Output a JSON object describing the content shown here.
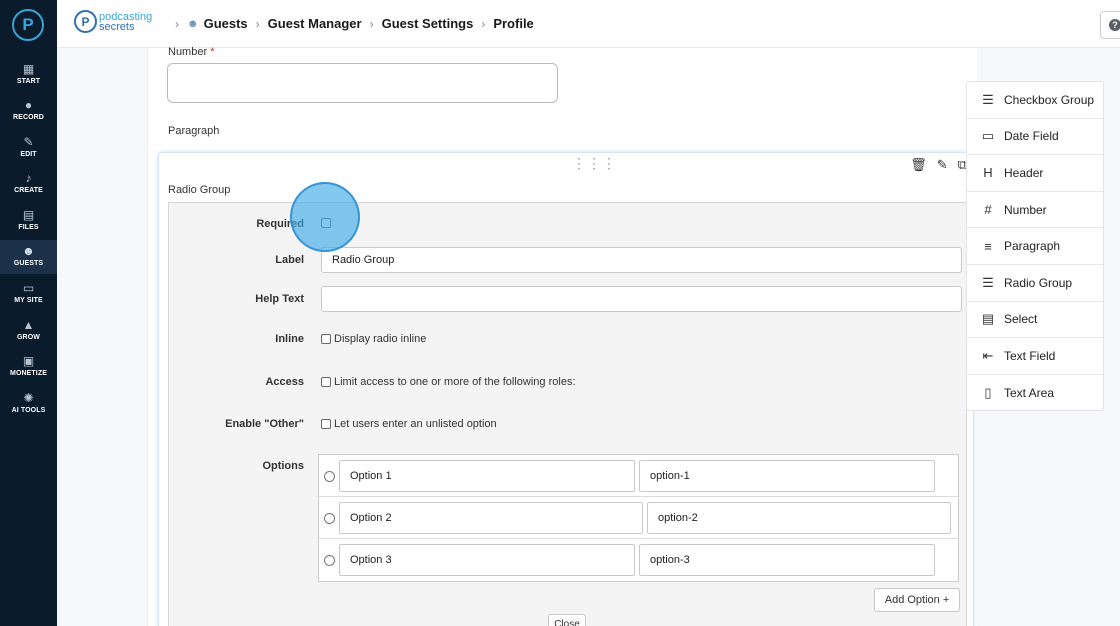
{
  "sidebar": {
    "logo_glyph": "P",
    "items": [
      {
        "label": "START",
        "icon": "start-icon",
        "glyph": "▦"
      },
      {
        "label": "RECORD",
        "icon": "microphone-icon",
        "glyph": "●"
      },
      {
        "label": "EDIT",
        "icon": "edit-icon",
        "glyph": "✎"
      },
      {
        "label": "CREATE",
        "icon": "create-icon",
        "glyph": "♪"
      },
      {
        "label": "FILES",
        "icon": "files-icon",
        "glyph": "▤"
      },
      {
        "label": "GUESTS",
        "icon": "guests-icon",
        "glyph": "☻",
        "active": true
      },
      {
        "label": "MY SITE",
        "icon": "my-site-icon",
        "glyph": "▭"
      },
      {
        "label": "GROW",
        "icon": "grow-icon",
        "glyph": "▲"
      },
      {
        "label": "MONETIZE",
        "icon": "monetize-icon",
        "glyph": "▣"
      },
      {
        "label": "AI TOOLS",
        "icon": "ai-tools-icon",
        "glyph": "✺"
      }
    ]
  },
  "header": {
    "brand_line1": "podcasting",
    "brand_line2": "secrets",
    "breadcrumbs": [
      "Guests",
      "Guest Manager",
      "Guest Settings",
      "Profile"
    ]
  },
  "form": {
    "number_label": "Number",
    "required_star": "*",
    "paragraph_label": "Paragraph",
    "radio_group_title": "Radio Group",
    "edit": {
      "required_label": "Required",
      "label_label": "Label",
      "label_value": "Radio Group",
      "help_text_label": "Help Text",
      "help_text_value": "",
      "inline_label": "Inline",
      "inline_text": "Display radio inline",
      "access_label": "Access",
      "access_text": "Limit access to one or more of the following roles:",
      "other_label": "Enable \"Other\"",
      "other_text": "Let users enter an unlisted option",
      "options_label": "Options",
      "options": [
        {
          "label": "Option 1",
          "value": "option-1"
        },
        {
          "label": "Option 2",
          "value": "option-2"
        },
        {
          "label": "Option 3",
          "value": "option-3"
        }
      ],
      "add_option": "Add Option +",
      "close": "Close"
    }
  },
  "controls": [
    {
      "label": "Checkbox Group",
      "icon": "checklist-icon",
      "glyph": "☰"
    },
    {
      "label": "Date Field",
      "icon": "calendar-icon",
      "glyph": "▭"
    },
    {
      "label": "Header",
      "icon": "header-icon",
      "glyph": "H"
    },
    {
      "label": "Number",
      "icon": "hash-icon",
      "glyph": "#"
    },
    {
      "label": "Paragraph",
      "icon": "paragraph-icon",
      "glyph": "≡"
    },
    {
      "label": "Radio Group",
      "icon": "radio-list-icon",
      "glyph": "☰"
    },
    {
      "label": "Select",
      "icon": "select-icon",
      "glyph": "▤"
    },
    {
      "label": "Text Field",
      "icon": "text-field-icon",
      "glyph": "⇤"
    },
    {
      "label": "Text Area",
      "icon": "text-area-icon",
      "glyph": "▯"
    }
  ],
  "colors": {
    "sidebar_bg": "#0a1b2c",
    "accent": "#3aa3d8",
    "brand": "#2f6fb3"
  }
}
